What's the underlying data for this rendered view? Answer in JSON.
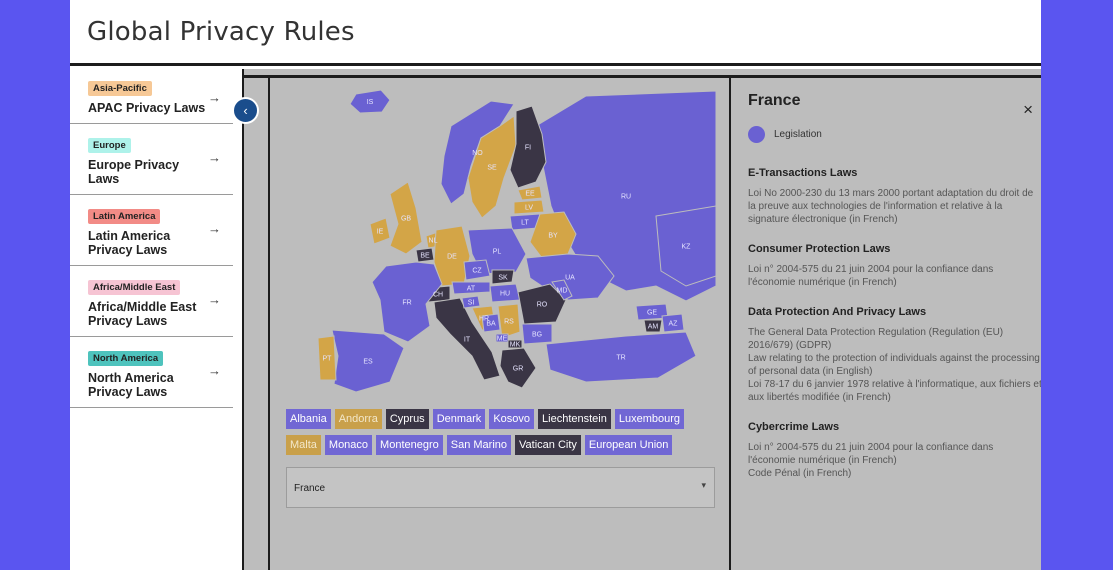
{
  "header": {
    "title": "Global Privacy Rules"
  },
  "sidebar": {
    "collapse_glyph": "‹",
    "items": [
      {
        "badge": "Asia-Pacific",
        "badge_color": "#f6c896",
        "label": "APAC Privacy Laws",
        "arrow": "→"
      },
      {
        "badge": "Europe",
        "badge_color": "#aef2ea",
        "label": "Europe Privacy Laws",
        "arrow": "→"
      },
      {
        "badge": "Latin America",
        "badge_color": "#f28b86",
        "label": "Latin America Privacy Laws",
        "arrow": "→"
      },
      {
        "badge": "Africa/Middle East",
        "badge_color": "#f6c4d3",
        "label": "Africa/Middle East Privacy Laws",
        "arrow": "→"
      },
      {
        "badge": "North America",
        "badge_color": "#4ec3bd",
        "label": "North America Privacy Laws",
        "arrow": "→"
      }
    ]
  },
  "map": {
    "colors": {
      "legislation": "#6a61d2",
      "draft": "#d3a547",
      "none": "#3a3545"
    },
    "labels": [
      "IS",
      "NO",
      "SE",
      "FI",
      "RU",
      "EE",
      "LV",
      "LT",
      "BY",
      "GB",
      "IE",
      "NL",
      "BE",
      "DE",
      "PL",
      "UA",
      "CZ",
      "SK",
      "AT",
      "CH",
      "HU",
      "FR",
      "MD",
      "RO",
      "SI",
      "HR",
      "BA",
      "RS",
      "IT",
      "ES",
      "PT",
      "ME",
      "KZ",
      "BG",
      "MK",
      "GE",
      "AM",
      "AZ",
      "GR",
      "TR"
    ]
  },
  "chips": {
    "row1": [
      {
        "label": "Albania",
        "style": "c-pur"
      },
      {
        "label": "Andorra",
        "style": "c-gold"
      },
      {
        "label": "Cyprus",
        "style": "c-dark"
      },
      {
        "label": "Denmark",
        "style": "c-pur"
      },
      {
        "label": "Kosovo",
        "style": "c-pur"
      },
      {
        "label": "Liechtenstein",
        "style": "c-dark"
      },
      {
        "label": "Luxembourg",
        "style": "c-pur"
      }
    ],
    "row2": [
      {
        "label": "Malta",
        "style": "c-gold"
      },
      {
        "label": "Monaco",
        "style": "c-pur"
      },
      {
        "label": "Montenegro",
        "style": "c-pur"
      },
      {
        "label": "San Marino",
        "style": "c-pur"
      },
      {
        "label": "Vatican City",
        "style": "c-dark"
      },
      {
        "label": "European Union",
        "style": "c-pur"
      }
    ]
  },
  "country_select": {
    "value": "France",
    "caret": "▾"
  },
  "detail": {
    "title": "France",
    "close": "×",
    "legend": "Legislation",
    "sections": [
      {
        "title": "E-Transactions Laws",
        "text": "Loi No 2000-230 du 13 mars 2000 portant adaptation du droit de la preuve aux technologies de l'information et relative à la signature électronique (in French)"
      },
      {
        "title": "Consumer Protection Laws",
        "text": "Loi n° 2004-575 du 21 juin 2004 pour la confiance dans l'économie numérique (in French)"
      },
      {
        "title": "Data Protection And Privacy Laws",
        "text": "The General Data Protection Regulation (Regulation (EU) 2016/679) (GDPR)\nLaw relating to the protection of individuals against the processing of personal data (in English)\nLoi 78-17 du 6 janvier 1978 relative à l'informatique, aux fichiers et aux libertés modifiée (in French)"
      },
      {
        "title": "Cybercrime Laws",
        "text": "Loi n° 2004-575 du 21 juin 2004 pour la confiance dans l'économie numérique (in French)\nCode Pénal (in French)"
      }
    ]
  }
}
